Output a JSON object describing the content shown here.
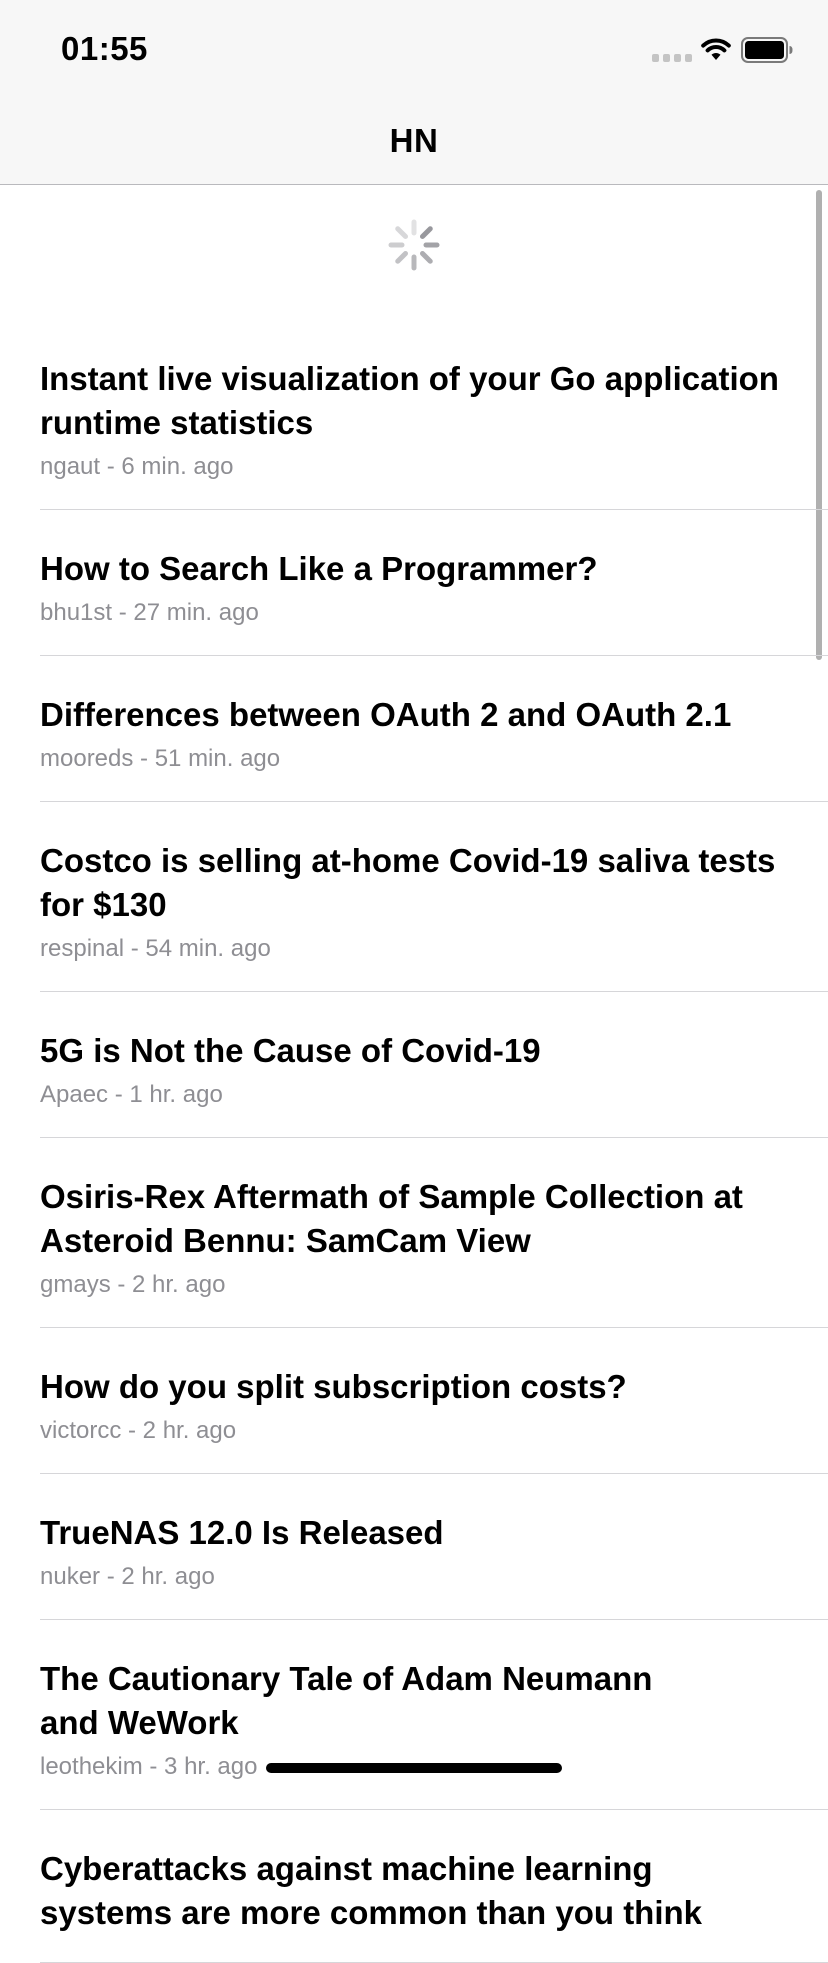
{
  "status_bar": {
    "time": "01:55"
  },
  "nav": {
    "title": "HN"
  },
  "stories": [
    {
      "title": "Instant live visualization of your Go application runtime statistics",
      "author": "ngaut",
      "age": "6 min. ago"
    },
    {
      "title": "How to Search Like a Programmer?",
      "author": "bhu1st",
      "age": "27 min. ago"
    },
    {
      "title": "Differences between OAuth 2 and OAuth 2.1",
      "author": "mooreds",
      "age": "51 min. ago"
    },
    {
      "title": "Costco is selling at-home Covid-19 saliva tests for $130",
      "author": "respinal",
      "age": "54 min. ago"
    },
    {
      "title": "5G is Not the Cause of Covid-19",
      "author": "Apaec",
      "age": "1 hr. ago"
    },
    {
      "title": "Osiris-Rex Aftermath of Sample Collection at Asteroid Bennu: SamCam View",
      "author": "gmays",
      "age": "2 hr. ago"
    },
    {
      "title": "How do you split subscription costs?",
      "author": "victorcc",
      "age": "2 hr. ago"
    },
    {
      "title": "TrueNAS 12.0 Is Released",
      "author": "nuker",
      "age": "2 hr. ago"
    },
    {
      "title": "The Cautionary Tale of Adam Neumann and WeWork",
      "author": "leothekim",
      "age": "3 hr. ago"
    },
    {
      "title": "Cyberattacks against machine learning systems are more common than you think",
      "author": "",
      "age": ""
    }
  ],
  "meta_separator": " - ",
  "icons": {
    "signal": "cellular-signal-icon",
    "wifi": "wifi-icon",
    "battery": "battery-icon",
    "loading": "loading-spinner-icon"
  },
  "colors": {
    "bar_background": "#f7f7f7",
    "meta_text": "#8e8e93",
    "separator": "#d6d6d9"
  }
}
